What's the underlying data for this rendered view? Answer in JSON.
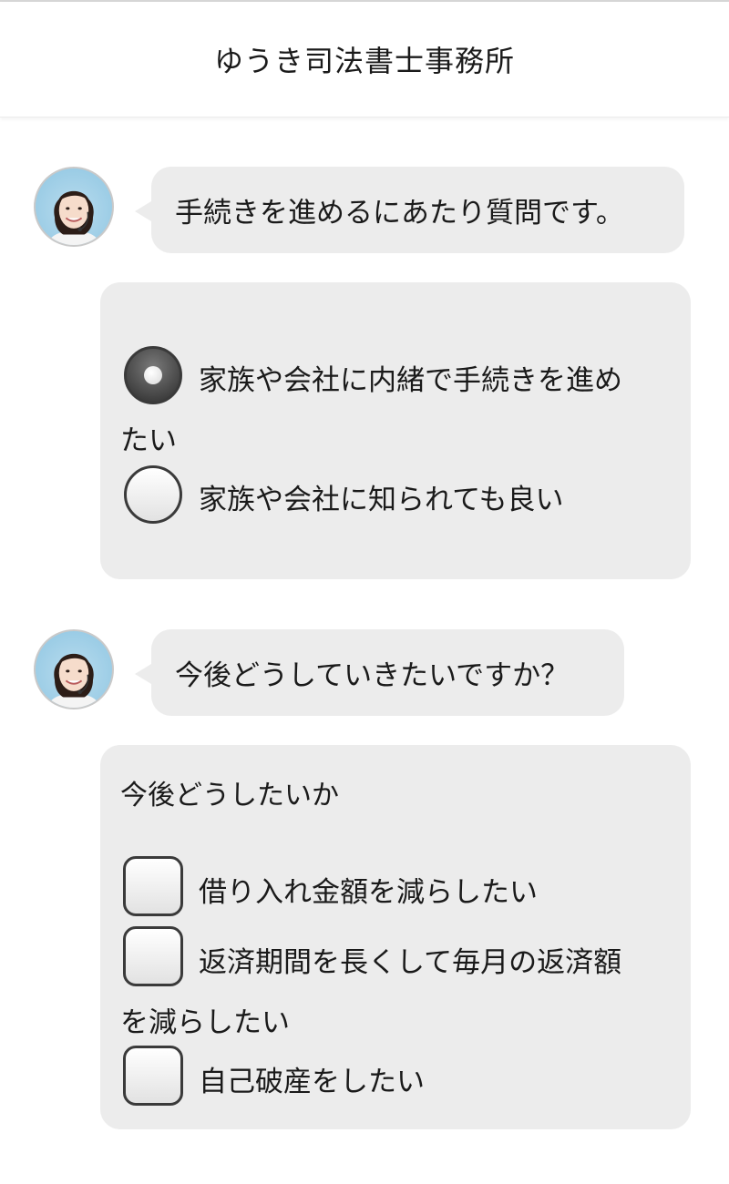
{
  "header": {
    "title": "ゆうき司法書士事務所"
  },
  "messages": [
    {
      "question": "手続きを進めるにあたり質問です。",
      "options": [
        {
          "label_line1": "家族や会社に内緒で手続きを進め",
          "label_line2": "たい",
          "selected": true
        },
        {
          "label": "家族や会社に知られても良い",
          "selected": false
        }
      ]
    },
    {
      "question": "今後どうしていきたいですか？",
      "group_label": "今後どうしたいか",
      "options": [
        {
          "label": "借り入れ金額を減らしたい",
          "checked": false
        },
        {
          "label_line1": "返済期間を長くして毎月の返済額",
          "label_line2": "を減らしたい",
          "checked": false
        },
        {
          "label": "自己破産をしたい",
          "checked": false
        }
      ]
    }
  ],
  "icons": {
    "avatar": "operator-avatar-icon",
    "radio": "radio-button",
    "checkbox": "checkbox"
  },
  "colors": {
    "bubble_bg": "#ececec",
    "border": "#3a3a3a",
    "background": "#ffffff"
  }
}
